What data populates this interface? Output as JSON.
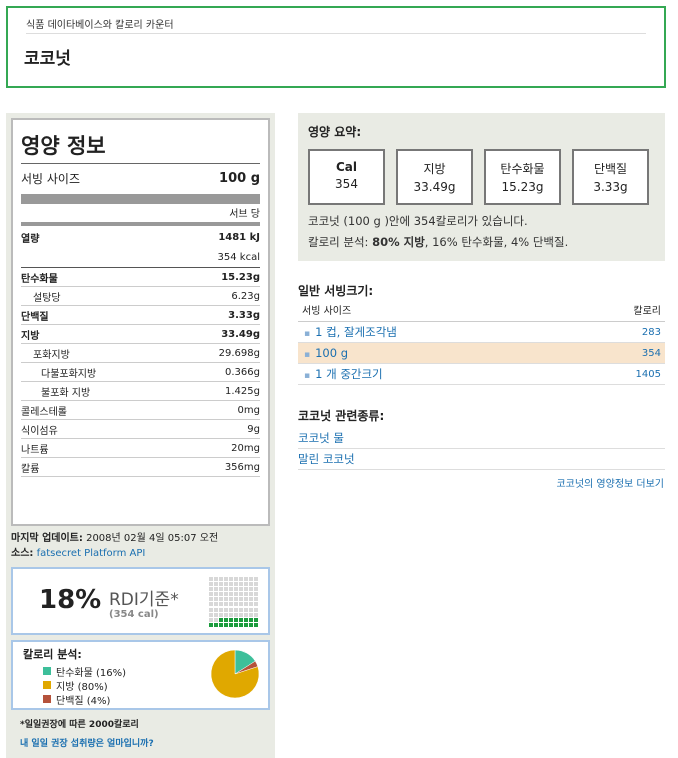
{
  "header": {
    "breadcrumb": "식품 데이타베이스와 칼로리 카운터",
    "title": "코코넛"
  },
  "nutrition": {
    "title": "영양 정보",
    "serving_label": "서빙 사이즈",
    "serving_value": "100 g",
    "per_serving": "서브 당",
    "rows": [
      {
        "label": "열량",
        "value": "1481 kJ"
      },
      {
        "label": "",
        "value": "354 kcal"
      },
      {
        "label": "탄수화물",
        "value": "15.23g"
      },
      {
        "label": "설탕당",
        "value": "6.23g"
      },
      {
        "label": "단백질",
        "value": "3.33g"
      },
      {
        "label": "지방",
        "value": "33.49g"
      },
      {
        "label": "포화지방",
        "value": "29.698g"
      },
      {
        "label": "다불포화지방",
        "value": "0.366g"
      },
      {
        "label": "불포화 지방",
        "value": "1.425g"
      },
      {
        "label": "콜레스테롤",
        "value": "0mg"
      },
      {
        "label": "식이섬유",
        "value": "9g"
      },
      {
        "label": "나트륨",
        "value": "20mg"
      },
      {
        "label": "칼륨",
        "value": "356mg"
      }
    ]
  },
  "meta": {
    "updated_label": "마지막 업데이트:",
    "updated_value": "2008년 02월 4일 05:07 오전",
    "source_label": "소스:",
    "source_value": "fatsecret Platform API"
  },
  "rdi": {
    "percent": "18%",
    "label": "RDI기준*",
    "calories": "(354 cal)",
    "filled_fraction": 0.18
  },
  "calorie_breakdown": {
    "title": "칼로리 분석:",
    "items": [
      {
        "label": "탄수화물 (16%)",
        "color": "#3dbf9a",
        "fraction": 0.16
      },
      {
        "label": "지방 (80%)",
        "color": "#e0a800",
        "fraction": 0.8
      },
      {
        "label": "단백질 (4%)",
        "color": "#b5523b",
        "fraction": 0.04
      }
    ]
  },
  "footnote": {
    "text": "*일일권장에 따른 2000칼로리",
    "link": "내 일일 권장 섭취량은 얼마입니까?"
  },
  "summary": {
    "title": "영양 요약:",
    "boxes": [
      {
        "label": "Cal",
        "value": "354"
      },
      {
        "label": "지방",
        "value": "33.49g"
      },
      {
        "label": "탄수화물",
        "value": "15.23g"
      },
      {
        "label": "단백질",
        "value": "3.33g"
      }
    ],
    "line1": "코코넛 (100 g )안에 354칼로리가 있습니다.",
    "line2_prefix": "칼로리 분석: ",
    "line2_fat": "80% 지방",
    "line2_rest": ", 16% 탄수화물, 4% 단백질."
  },
  "servings": {
    "title": "일반 서빙크기:",
    "col_size": "서빙 사이즈",
    "col_cal": "칼로리",
    "rows": [
      {
        "name": "1 컵, 잘게조각냄",
        "cal": "283"
      },
      {
        "name": "100 g",
        "cal": "354"
      },
      {
        "name": "1 개 중간크기",
        "cal": "1405"
      }
    ]
  },
  "related": {
    "title": "코코넛 관련종류:",
    "items": [
      "코코넛 물",
      "말린 코코넛"
    ],
    "more": "코코넛의 영양정보 더보기"
  }
}
